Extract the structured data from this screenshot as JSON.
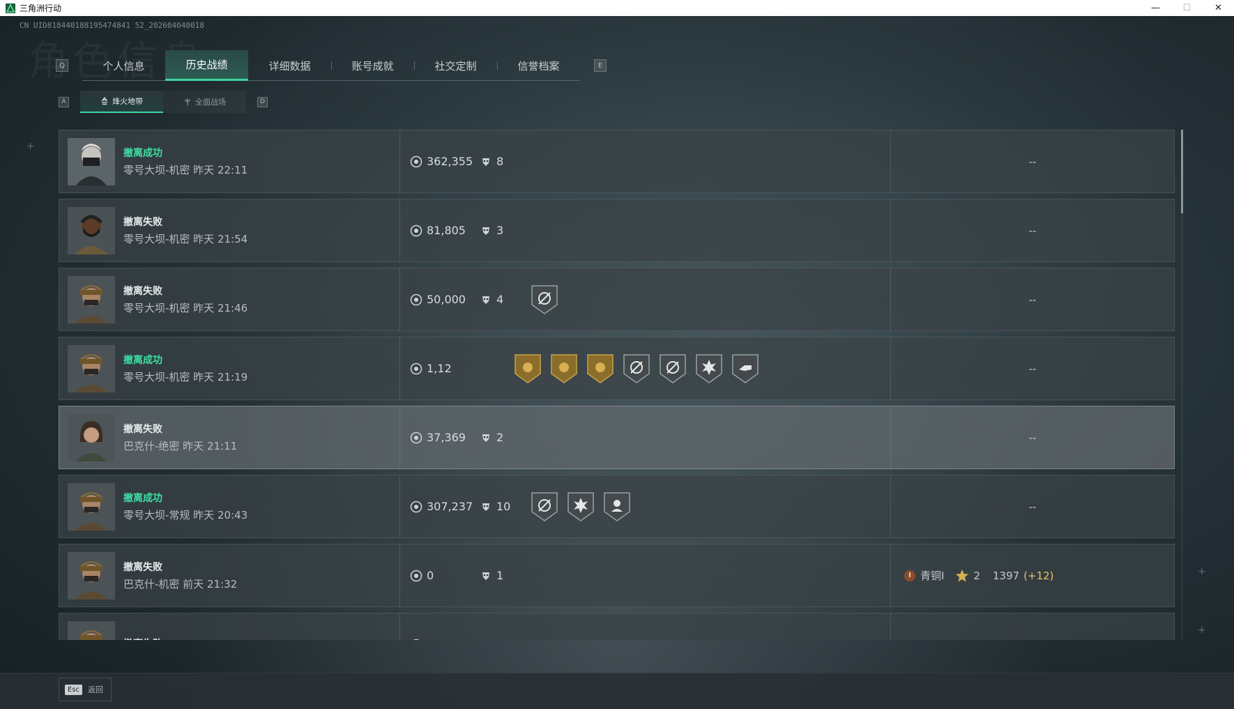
{
  "window": {
    "title": "三角洲行动",
    "minimize": "—",
    "maximize": "☐",
    "close": "✕"
  },
  "uid": "CN UID818440188195474841 52_202604040018",
  "watermark": "角色信息",
  "tabs": {
    "key_left": "Q",
    "key_right": "E",
    "items": [
      "个人信息",
      "历史战绩",
      "详细数据",
      "账号成就",
      "社交定制",
      "信誉档案"
    ],
    "active": "历史战绩"
  },
  "subtabs": {
    "key_left": "A",
    "key_right": "D",
    "items": [
      "烽火地带",
      "全面战场"
    ],
    "active": "烽火地带"
  },
  "records": [
    {
      "status": "撤离成功",
      "success": true,
      "map": "零号大坝-机密 昨天 22:11",
      "value": "362,355",
      "kills": "8",
      "badges": [],
      "rank": "--",
      "avatar": "masked-woman"
    },
    {
      "status": "撤离失败",
      "success": false,
      "map": "零号大坝-机密 昨天 21:54",
      "value": "81,805",
      "kills": "3",
      "badges": [],
      "rank": "--",
      "avatar": "bearded-man"
    },
    {
      "status": "撤离失败",
      "success": false,
      "map": "零号大坝-机密 昨天 21:46",
      "value": "50,000",
      "kills": "4",
      "badges": [
        "crosshair-badge"
      ],
      "rank": "--",
      "avatar": "helmet-soldier"
    },
    {
      "status": "撤离成功",
      "success": true,
      "map": "零号大坝-机密 昨天 21:19",
      "value": "1,12",
      "kills": "",
      "badges": [
        "gold-badge",
        "gold-badge",
        "gold-badge",
        "crosshair-badge",
        "crosshair-badge",
        "explosion-badge",
        "hand-badge"
      ],
      "rank": "--",
      "avatar": "helmet-soldier"
    },
    {
      "status": "撤离失败",
      "success": false,
      "map": "巴克什-绝密 昨天 21:11",
      "value": "37,369",
      "kills": "2",
      "badges": [],
      "rank": "--",
      "avatar": "hooded-woman"
    },
    {
      "status": "撤离成功",
      "success": true,
      "map": "零号大坝-常规 昨天 20:43",
      "value": "307,237",
      "kills": "10",
      "badges": [
        "crosshair-badge",
        "explosion-badge",
        "medic-badge"
      ],
      "rank": "--",
      "avatar": "helmet-soldier"
    },
    {
      "status": "撤离失败",
      "success": false,
      "map": "巴克什-机密 前天 21:32",
      "value": "0",
      "kills": "1",
      "badges": [],
      "rank": "",
      "rank_tier": "青铜I",
      "rank_stars": "2",
      "rank_score": "1397",
      "rank_gain": "(+12)",
      "avatar": "helmet-soldier"
    },
    {
      "status": "撤离失败",
      "success": false,
      "map": "",
      "value": "",
      "kills": "",
      "badges": [],
      "rank": "",
      "avatar": "helmet-soldier"
    }
  ],
  "footer": {
    "key": "Esc",
    "label": "返回"
  },
  "colors": {
    "accent": "#3fd6a0",
    "success": "#3fe0a8",
    "gain": "#e8c468"
  }
}
